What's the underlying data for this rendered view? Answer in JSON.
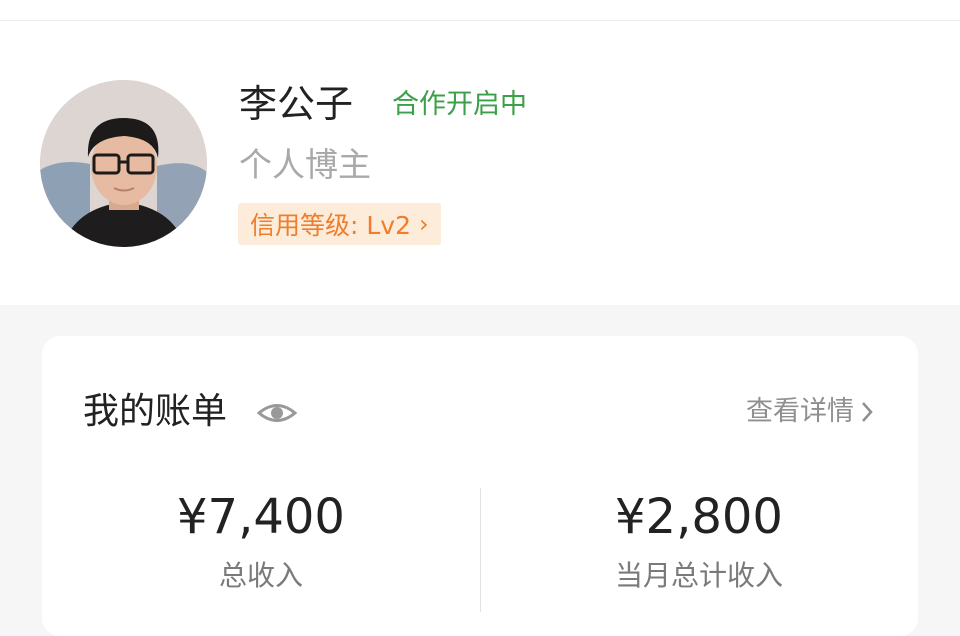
{
  "profile": {
    "name": "李公子",
    "cooperation_status": "合作开启中",
    "role": "个人博主",
    "credit_level": "信用等级: Lv2",
    "avatar_icon": "user-avatar"
  },
  "bill": {
    "title": "我的账单",
    "visibility_icon": "eye-icon",
    "details_label": "查看详情",
    "stats": [
      {
        "value": "¥7,400",
        "label": "总收入"
      },
      {
        "value": "¥2,800",
        "label": "当月总计收入"
      }
    ]
  },
  "colors": {
    "status_green": "#3aa148",
    "credit_orange": "#ee7e2d",
    "credit_bg": "#fdecd9",
    "page_bg": "#f6f6f6"
  }
}
